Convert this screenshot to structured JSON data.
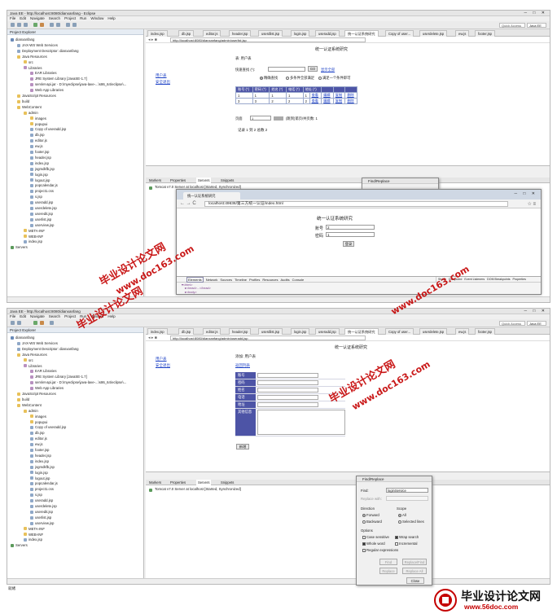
{
  "screens": [
    {
      "window_title": "Java EE - http://localhost:8080/dianxanfang - Eclipse",
      "menu": [
        "File",
        "Edit",
        "Navigate",
        "Search",
        "Project",
        "Run",
        "Window",
        "Help"
      ],
      "quick_access": "Quick Access",
      "perspective": "Java EE",
      "explorer_title": "Project Explorer",
      "tree": [
        {
          "label": "dianxanfang",
          "icon": "project-icon",
          "depth": 0
        },
        {
          "label": "JAX-WS Web Services",
          "icon": "file-icon",
          "depth": 1
        },
        {
          "label": "Deployment Descriptor: dianxanfang",
          "icon": "file-icon",
          "depth": 1
        },
        {
          "label": "Java Resources",
          "icon": "folder-icon",
          "depth": 1
        },
        {
          "label": "src",
          "icon": "folder-icon",
          "depth": 2
        },
        {
          "label": "Libraries",
          "icon": "library-icon",
          "depth": 2
        },
        {
          "label": "EAR Libraries",
          "icon": "library-icon",
          "depth": 3
        },
        {
          "label": "JRE System Library [JavaSE-1.7]",
          "icon": "library-icon",
          "depth": 3
        },
        {
          "label": "servlet-api.jar - D:\\myeclipse\\java-lave-...\\s86_64\\eclipse\\...",
          "icon": "library-icon",
          "depth": 3
        },
        {
          "label": "Web App Libraries",
          "icon": "library-icon",
          "depth": 3
        },
        {
          "label": "JavaScript Resources",
          "icon": "folder-icon",
          "depth": 1
        },
        {
          "label": "build",
          "icon": "folder-icon",
          "depth": 1
        },
        {
          "label": "WebContent",
          "icon": "folder-icon",
          "depth": 1
        },
        {
          "label": "admin",
          "icon": "folder-icon",
          "depth": 2
        },
        {
          "label": "images",
          "icon": "folder-icon",
          "depth": 3
        },
        {
          "label": "popupui",
          "icon": "folder-icon",
          "depth": 3
        },
        {
          "label": "Copy of useradd.jsp",
          "icon": "file-icon",
          "depth": 3
        },
        {
          "label": "db.jsp",
          "icon": "file-icon",
          "depth": 3
        },
        {
          "label": "editor.js",
          "icon": "file-icon",
          "depth": 3
        },
        {
          "label": "ew.js",
          "icon": "file-icon",
          "depth": 3
        },
        {
          "label": "footer.jsp",
          "icon": "file-icon",
          "depth": 3
        },
        {
          "label": "header.jsp",
          "icon": "file-icon",
          "depth": 3
        },
        {
          "label": "index.jsp",
          "icon": "file-icon",
          "depth": 3
        },
        {
          "label": "jsgmdkfb.jsp",
          "icon": "file-icon",
          "depth": 3
        },
        {
          "label": "login.jsp",
          "icon": "file-icon",
          "depth": 3
        },
        {
          "label": "logout.jsp",
          "icon": "file-icon",
          "depth": 3
        },
        {
          "label": "popcalendar.js",
          "icon": "file-icon",
          "depth": 3
        },
        {
          "label": "project1.css",
          "icon": "file-icon",
          "depth": 3
        },
        {
          "label": "s.jsp",
          "icon": "file-icon",
          "depth": 3
        },
        {
          "label": "useradd.jsp",
          "icon": "file-icon",
          "depth": 3
        },
        {
          "label": "userdelete.jsp",
          "icon": "file-icon",
          "depth": 3
        },
        {
          "label": "useredit.jsp",
          "icon": "file-icon",
          "depth": 3
        },
        {
          "label": "userlist.jsp",
          "icon": "file-icon",
          "depth": 3
        },
        {
          "label": "userview.jsp",
          "icon": "file-icon",
          "depth": 3
        },
        {
          "label": "META-INF",
          "icon": "folder-icon",
          "depth": 2
        },
        {
          "label": "WEB-INF",
          "icon": "folder-icon",
          "depth": 2
        },
        {
          "label": "index.jsp",
          "icon": "file-icon",
          "depth": 2
        },
        {
          "label": "Servers",
          "icon": "server-icon",
          "depth": 0
        }
      ],
      "editor_tabs": [
        "index.jsp",
        "db.jsp",
        "editor.js",
        "header.jsp",
        "userdlist.jsp",
        "login.jsp",
        "useradd.jsp",
        "统一认证系统研究",
        "Copy of user...",
        "userdelete.jsp",
        "ew.js",
        "footer.jsp"
      ],
      "url": "http://localhost:8080/dianxanfang/admin/userlist.jsp",
      "page": {
        "heading": "统一认证系统研究",
        "side_links": [
          "用户表",
          "安全退出"
        ],
        "table_caption": "表: 用户表",
        "search_label": "快速查找 (*):",
        "go_button": "GO",
        "show_all": "显示全部",
        "radio_options": [
          "精确查找",
          "多条件全部满足",
          "满足一个条件即可"
        ],
        "columns": [
          "账号 (*)",
          "密码 (*)",
          "姓名 (*)",
          "电话 (*)",
          "地址 (*)",
          "",
          "",
          ""
        ],
        "rows": [
          [
            "1",
            "1",
            "1",
            "1",
            "1",
            "查看",
            "编辑",
            "复制",
            "删除"
          ],
          [
            "3",
            "3",
            "2",
            "2",
            "2",
            "查看",
            "编辑",
            "复制",
            "删除"
          ]
        ],
        "pager_label": "页面",
        "pager_value": "1",
        "pager_info": "(跳到)第页/共页数: 1",
        "records": "记录 1 到 2 总数 2"
      },
      "bottom_tabs": [
        "Markers",
        "Properties",
        "Servers",
        "Snippets"
      ],
      "server_entry": "Tomcat v7.0 Server at localhost  [Started, Synchronized]",
      "find_replace_title": "Find/Replace",
      "browser": {
        "tab_title": "统一认证系统研究",
        "url": "localhost:49636/第三方统一认证/index.html",
        "heading": "统一认证系统研究",
        "account_label": "账号",
        "account_value": "2",
        "password_label": "密码",
        "password_value": "1",
        "login_button": "登录",
        "devtools_tabs": [
          "Elements",
          "Network",
          "Sources",
          "Timeline",
          "Profiles",
          "Resources",
          "Audits",
          "Console"
        ],
        "devtools_side_tabs": [
          "Styles",
          "Computed",
          "Event Listeners",
          "DOM Breakpoints",
          "Properties"
        ],
        "devtools_lines": [
          "▾<html>",
          "▸<head>...</head>",
          "▸<body>"
        ]
      }
    },
    {
      "window_title": "Java EE - http://localhost:8080/dianxanfang",
      "menu": [
        "File",
        "Edit",
        "Navigate",
        "Search",
        "Project",
        "Run",
        "Window",
        "Help"
      ],
      "url": "http://localhost:8080/dianxanfang/admin/useradd.jsp",
      "page": {
        "heading": "统一认证系统研究",
        "side_links": [
          "用户表",
          "安全退出"
        ],
        "add_title": "添加: 用户表",
        "back_link": "返回列表",
        "fields": [
          "账号",
          "密码",
          "姓名",
          "电话",
          "地址",
          "其他信息"
        ],
        "add_button": "新增"
      },
      "find": {
        "title": "Find/Replace",
        "find_label": "Find:",
        "find_value": "loginService",
        "replace_label": "Replace with:",
        "direction_label": "Direction",
        "forward": "Forward",
        "backward": "Backward",
        "scope_label": "Scope",
        "all": "All",
        "selected": "Selected lines",
        "options_label": "Options",
        "case": "Case sensitive",
        "wrap": "Wrap search",
        "whole": "Whole word",
        "incremental": "Incremental",
        "regex": "Regular expressions",
        "buttons": [
          "Find",
          "Replace/Find",
          "Replace",
          "Replace All"
        ],
        "close": "Close"
      }
    }
  ],
  "status": "就绪",
  "watermarks": {
    "big1": "毕业设计论文网",
    "url1": "www.doc163.com",
    "logo_text": "毕业设计论文网",
    "logo_url": "www.56doc.com"
  }
}
